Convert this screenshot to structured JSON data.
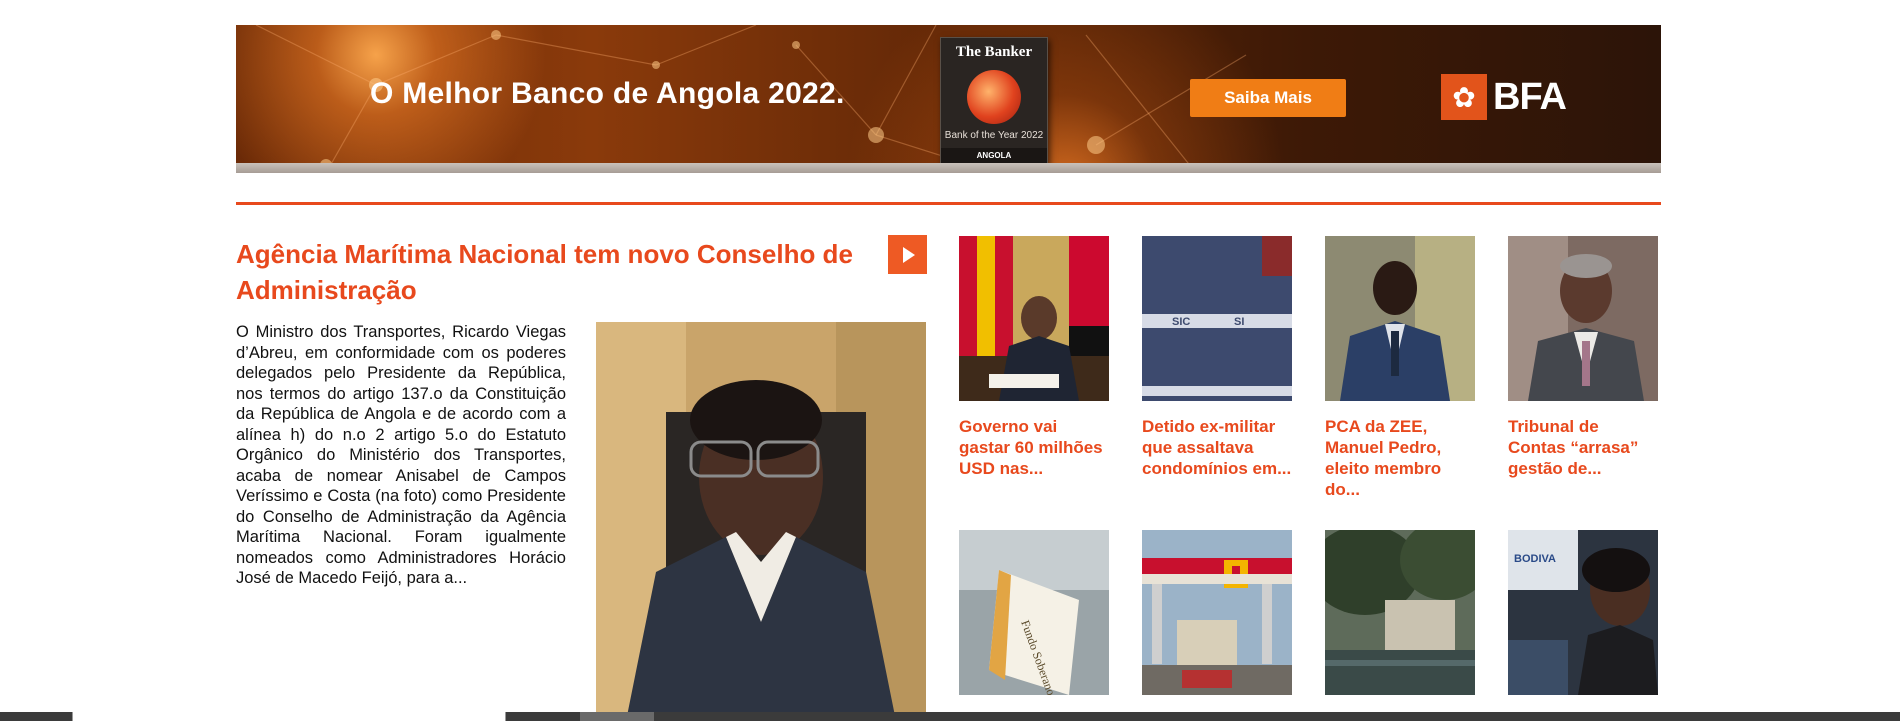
{
  "banner": {
    "headline": "O Melhor Banco de Angola 2022.",
    "award_masthead": "The Banker",
    "award_subtitle": "Bank of the Year 2022",
    "award_country": "ANGOLA",
    "cta_label": "Saiba Mais",
    "brand_name": "BFA",
    "brand_color": "#e2541b",
    "cta_color": "#f07d15"
  },
  "accent_color": "#e8491d",
  "main_story": {
    "title": "Agência Marítima Nacional tem novo Conselho de Administração",
    "play_icon": "play-icon",
    "body": "O Ministro dos Transportes, Ricardo Viegas d’Abreu, em conformidade com os poderes delegados pelo Presidente da República, nos termos do artigo 137.o da Constituição da República de Angola e de acordo com a alínea h) do n.o 2 artigo 5.o do Estatuto Orgânico do Ministério dos Transportes, acaba de nomear Anisabel de Campos Veríssimo e Costa (na foto) como Presidente do Conselho de Administração da Agência Marítima Nacional. Foram igualmente nomeados como Administradores Horácio José de Macedo Feijó, para a..."
  },
  "grid": {
    "row1": [
      {
        "caption": "Governo vai gastar 60 milhões USD nas..."
      },
      {
        "caption": "Detido ex-militar que assaltava condomínios em...",
        "vest_text": "SIC"
      },
      {
        "caption": "PCA da ZEE, Manuel Pedro, eleito membro do..."
      },
      {
        "caption": "Tribunal de Contas “arrasa” gestão de..."
      }
    ],
    "row2": [
      {
        "flag_text": "Fundo Soberano Angola"
      },
      {
        "station_text": ""
      },
      {
        "scene": ""
      },
      {
        "sign_text": "BODIVA"
      }
    ]
  }
}
